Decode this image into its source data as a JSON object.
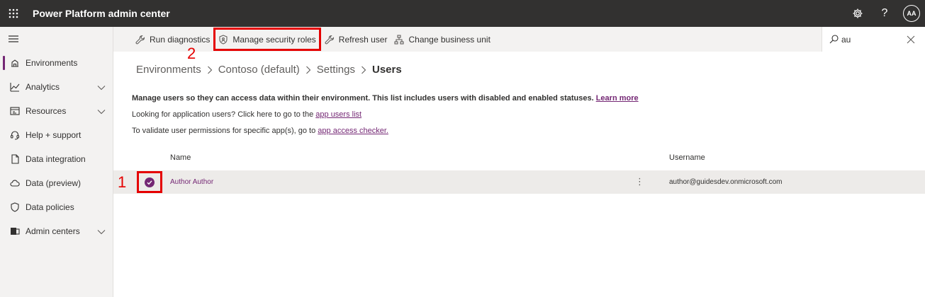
{
  "app": {
    "title": "Power Platform admin center",
    "avatar_initials": "AA"
  },
  "topbar_icons": [
    "waffle-icon",
    "gear-icon",
    "help-icon"
  ],
  "help_glyph": "?",
  "sidebar": {
    "items": [
      {
        "label": "Environments",
        "icon": "environments-icon",
        "active": true,
        "expandable": false
      },
      {
        "label": "Analytics",
        "icon": "analytics-icon",
        "expandable": true
      },
      {
        "label": "Resources",
        "icon": "resources-icon",
        "expandable": true
      },
      {
        "label": "Help + support",
        "icon": "headset-icon",
        "expandable": false
      },
      {
        "label": "Data integration",
        "icon": "data-integration-icon",
        "expandable": false
      },
      {
        "label": "Data (preview)",
        "icon": "cloud-icon",
        "expandable": false
      },
      {
        "label": "Data policies",
        "icon": "shield-icon",
        "expandable": false
      },
      {
        "label": "Admin centers",
        "icon": "admin-centers-icon",
        "expandable": true
      }
    ]
  },
  "commandbar": {
    "run_diagnostics": "Run diagnostics",
    "manage_security_roles": "Manage security roles",
    "refresh_user": "Refresh user",
    "change_business_unit": "Change business unit",
    "search_value": "au"
  },
  "breadcrumb": {
    "items": [
      "Environments",
      "Contoso (default)",
      "Settings"
    ],
    "current": "Users"
  },
  "description": {
    "line1": "Manage users so they can access data within their environment. This list includes users with disabled and enabled statuses.",
    "line1_link": "Learn more",
    "line2": "Looking for application users? Click here to go to the",
    "line2_link": "app users list",
    "line3": "To validate user permissions for specific app(s), go to",
    "line3_link": "app access checker."
  },
  "table": {
    "columns": [
      "Name",
      "Username"
    ],
    "rows": [
      {
        "name": "Author Author",
        "username": "author@guidesdev.onmicrosoft.com",
        "selected": true,
        "more_glyph": "⋮"
      }
    ]
  },
  "annotations": {
    "marker_1": "1",
    "marker_2": "2"
  },
  "colors": {
    "accent": "#742774",
    "topbar": "#323130",
    "highlight": "#e50000",
    "sidebar_bg": "#f3f2f1"
  }
}
